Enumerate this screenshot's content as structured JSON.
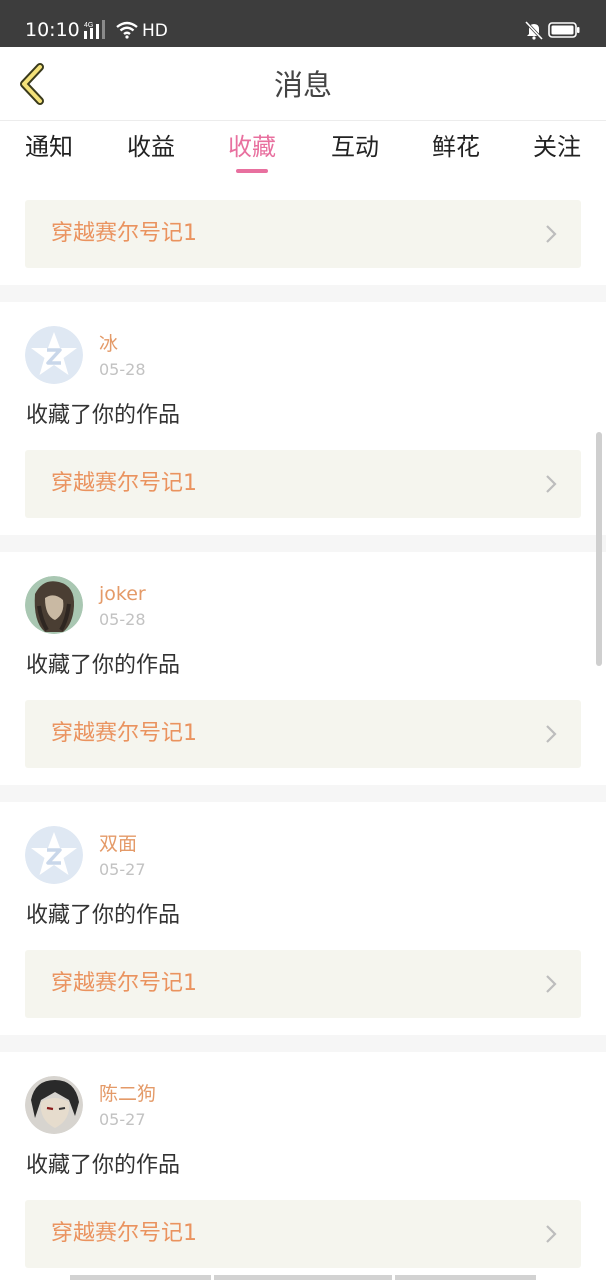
{
  "status_bar": {
    "time": "10:10",
    "network": "4G",
    "hd": "HD"
  },
  "header": {
    "title": "消息"
  },
  "tabs": [
    {
      "label": "通知"
    },
    {
      "label": "收益"
    },
    {
      "label": "收藏",
      "active": true
    },
    {
      "label": "互动"
    },
    {
      "label": "鲜花"
    },
    {
      "label": "关注"
    }
  ],
  "feed": [
    {
      "work_title": "穿越赛尔号记1"
    },
    {
      "user": "冰",
      "date": "05-28",
      "action": "收藏了你的作品",
      "work_title": "穿越赛尔号记1",
      "avatar": "default-avatar"
    },
    {
      "user": "joker",
      "date": "05-28",
      "action": "收藏了你的作品",
      "work_title": "穿越赛尔号记1",
      "avatar": "photo-avatar"
    },
    {
      "user": "双面",
      "date": "05-27",
      "action": "收藏了你的作品",
      "work_title": "穿越赛尔号记1",
      "avatar": "default-avatar"
    },
    {
      "user": "陈二狗",
      "date": "05-27",
      "action": "收藏了你的作品",
      "work_title": "穿越赛尔号记1",
      "avatar": "photo-avatar"
    }
  ],
  "colors": {
    "accent": "#e8709f",
    "username": "#e49a68",
    "work_title": "#ea935f",
    "card_bg": "#f5f5ee"
  }
}
